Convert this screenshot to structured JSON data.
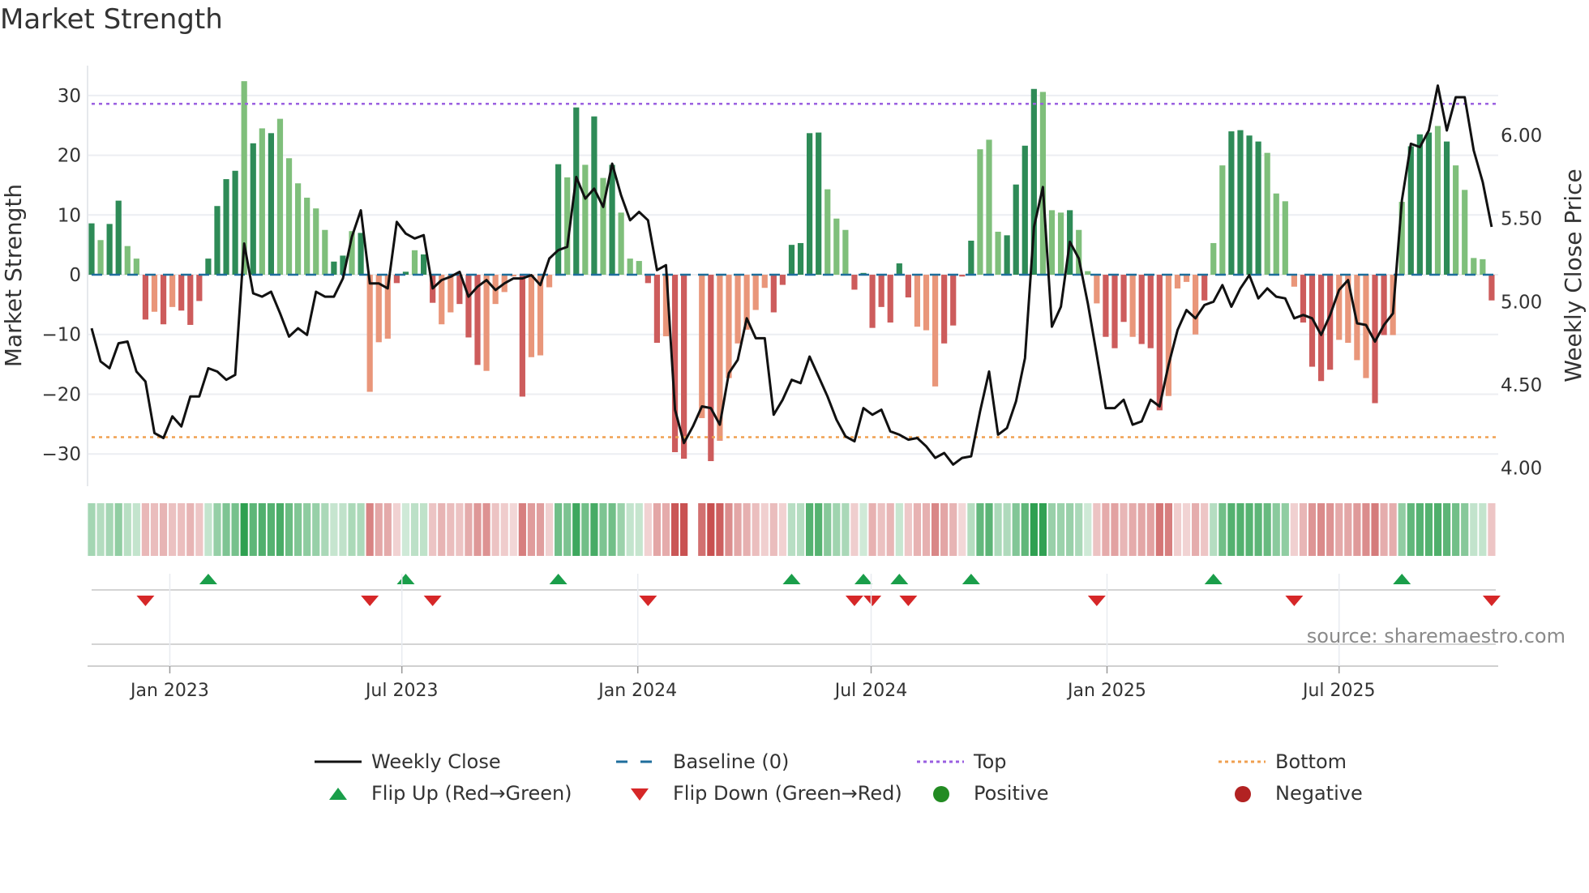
{
  "title": "Market Strength",
  "source": "source: sharemaestro.com",
  "chart_data": {
    "type": "bar+line",
    "title": "Market Strength",
    "ylabel_left": "Market Strength",
    "ylabel_right": "Weekly Close Price",
    "ylim_left": [
      -35.4,
      35
    ],
    "ylim_right": [
      3.89,
      6.42
    ],
    "left_ticks": [
      {
        "v": 30,
        "label": "30"
      },
      {
        "v": 20,
        "label": "20"
      },
      {
        "v": 10,
        "label": "10"
      },
      {
        "v": 0,
        "label": "0"
      },
      {
        "v": -10,
        "label": "−10"
      },
      {
        "v": -20,
        "label": "−20"
      },
      {
        "v": -30,
        "label": "−30"
      }
    ],
    "right_ticks": [
      {
        "v": 6.0,
        "label": "6.00"
      },
      {
        "v": 5.5,
        "label": "5.50"
      },
      {
        "v": 5.0,
        "label": "5.00"
      },
      {
        "v": 4.5,
        "label": "4.50"
      },
      {
        "v": 4.0,
        "label": "4.00"
      }
    ],
    "x_ticks": [
      {
        "date": "2023-01-01",
        "label": "Jan 2023"
      },
      {
        "date": "2023-07-01",
        "label": "Jul 2023"
      },
      {
        "date": "2024-01-01",
        "label": "Jan 2024"
      },
      {
        "date": "2024-07-01",
        "label": "Jul 2024"
      },
      {
        "date": "2025-01-01",
        "label": "Jan 2025"
      },
      {
        "date": "2025-07-01",
        "label": "Jul 2025"
      }
    ],
    "first_week": "2022-11-01",
    "top_level": 28.6,
    "bottom_level": -27.2,
    "baseline": 0,
    "strength": [
      8.6,
      5.8,
      8.5,
      12.4,
      4.8,
      2.7,
      -7.5,
      -6.2,
      -8.3,
      -5.4,
      -6,
      -8.4,
      -4.4,
      2.7,
      11.5,
      16,
      17.4,
      32.4,
      22,
      24.5,
      23.7,
      26.1,
      19.5,
      15.3,
      12.9,
      11.1,
      7.5,
      2.2,
      3.2,
      7.3,
      7.0,
      -19.6,
      -11.3,
      -10.7,
      -1.4,
      0.5,
      4.1,
      3.4,
      -4.7,
      -8.3,
      -6.3,
      -4.9,
      -10.5,
      -15.1,
      -16.1,
      -4.9,
      -2.9,
      -0.3,
      -20.4,
      -13.8,
      -13.5,
      -2.1,
      18.5,
      16.3,
      28,
      18.4,
      26.5,
      16.2,
      18.4,
      10.4,
      2.7,
      2.3,
      -1.4,
      -11.4,
      -10.3,
      -29.7,
      -30.8,
      null,
      -24,
      -31.2,
      -27.8,
      -17.3,
      -11.5,
      -9.2,
      -5.9,
      -2.2,
      -6.3,
      -1.7,
      5.0,
      5.3,
      23.7,
      23.8,
      14.3,
      9.4,
      7.5,
      -2.5,
      0.3,
      -8.9,
      -5.4,
      -8.0,
      1.9,
      -3.8,
      -8.7,
      -9.3,
      -18.7,
      -11.5,
      -8.5,
      -0.3,
      5.7,
      21,
      22.6,
      7.2,
      6.6,
      15.1,
      21.6,
      31.1,
      30.6,
      10.8,
      10.4,
      10.8,
      7.5,
      0.6,
      -4.8,
      -10.4,
      -12.3,
      -7.9,
      -10.4,
      -11.6,
      -12.3,
      -22.7,
      -20.3,
      -2.3,
      -1.2,
      -10,
      -4.3,
      5.3,
      18.3,
      24,
      24.2,
      23.3,
      22.3,
      20.4,
      13.6,
      12.3,
      -2,
      -8,
      -15.4,
      -17.8,
      -15.9,
      -10.9,
      -11.4,
      -14.3,
      -17.3,
      -21.5,
      -10.1,
      -10.1,
      12.2,
      21.5,
      23.5,
      23.8,
      24.9,
      22.3,
      18.3,
      14.2,
      2.8,
      2.6,
      -4.3
    ],
    "shade": "dlddlldldldddddddldldllllllddldlllddldd lldddlllldllldldldldlllddlddnldllllllddddddllldddddddlllddddlllddddllldllldddldddlllldllddddllllddddllllddlldddldlllld",
    "weekly_close": [
      4.84,
      4.64,
      4.6,
      4.75,
      4.76,
      4.58,
      4.52,
      4.21,
      4.18,
      4.31,
      4.25,
      4.43,
      4.43,
      4.6,
      4.58,
      4.53,
      4.56,
      5.35,
      5.05,
      5.03,
      5.06,
      4.93,
      4.79,
      4.84,
      4.8,
      5.06,
      5.03,
      5.03,
      5.14,
      5.39,
      5.55,
      5.11,
      5.11,
      5.08,
      5.48,
      5.41,
      5.38,
      5.4,
      5.08,
      5.13,
      5.15,
      5.18,
      5.03,
      5.09,
      5.13,
      5.07,
      5.11,
      5.14,
      5.14,
      5.16,
      5.1,
      5.26,
      5.31,
      5.33,
      5.75,
      5.62,
      5.68,
      5.57,
      5.83,
      5.64,
      5.49,
      5.54,
      5.49,
      5.19,
      5.22,
      4.35,
      4.15,
      4.25,
      4.37,
      4.36,
      4.26,
      4.57,
      4.65,
      4.9,
      4.78,
      4.78,
      4.32,
      4.41,
      4.53,
      4.51,
      4.67,
      4.55,
      4.43,
      4.29,
      4.19,
      4.16,
      4.36,
      4.32,
      4.35,
      4.22,
      4.2,
      4.17,
      4.18,
      4.13,
      4.06,
      4.09,
      4.02,
      4.06,
      4.07,
      4.34,
      4.58,
      4.2,
      4.24,
      4.4,
      4.66,
      5.45,
      5.69,
      4.85,
      4.97,
      5.36,
      5.26,
      4.99,
      4.68,
      4.36,
      4.36,
      4.41,
      4.26,
      4.28,
      4.41,
      4.37,
      4.62,
      4.83,
      4.95,
      4.9,
      4.98,
      5.0,
      5.1,
      4.97,
      5.08,
      5.16,
      5.02,
      5.08,
      5.03,
      5.02,
      4.9,
      4.92,
      4.9,
      4.8,
      4.92,
      5.07,
      5.13,
      4.87,
      4.86,
      4.76,
      4.86,
      4.93,
      5.61,
      5.95,
      5.93,
      6.03,
      6.3,
      6.03,
      6.23,
      6.23,
      5.91,
      5.72,
      5.45
    ],
    "legend_position": "bottom",
    "legend": [
      {
        "key": "close",
        "label": "Weekly Close"
      },
      {
        "key": "baseline",
        "label": "Baseline (0)"
      },
      {
        "key": "top",
        "label": "Top"
      },
      {
        "key": "bottom",
        "label": "Bottom"
      },
      {
        "key": "flipup",
        "label": "Flip Up (Red→Green)"
      },
      {
        "key": "flipdown",
        "label": "Flip Down (Green→Red)"
      },
      {
        "key": "pos",
        "label": "Positive"
      },
      {
        "key": "neg",
        "label": "Negative"
      }
    ],
    "colors": {
      "pos_dark": "#2e8b57",
      "pos_light": "#7fbf7b",
      "neg_dark": "#cd5c5c",
      "neg_light": "#e9967a",
      "line": "#111111",
      "baseline": "#1f6e9c",
      "top": "#9a5fe0",
      "bottom": "#f0a050",
      "flip_up": "#1a9e4a",
      "flip_down": "#d62728",
      "positive": "#228b22",
      "negative": "#b22222"
    }
  }
}
